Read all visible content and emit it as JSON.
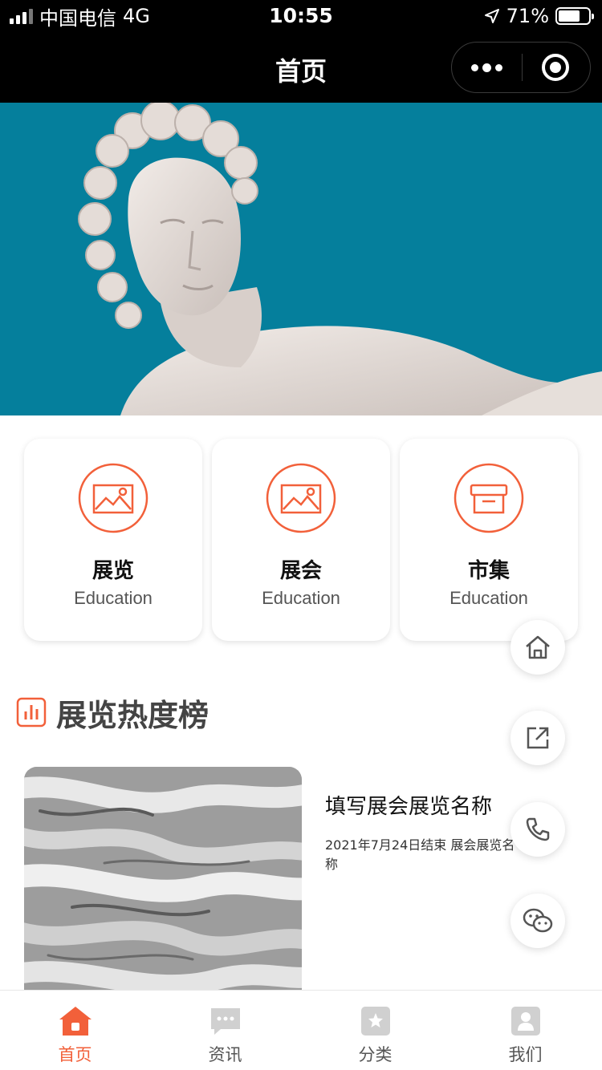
{
  "status_bar": {
    "carrier": "中国电信",
    "network": "4G",
    "time": "10:55",
    "battery": "71%",
    "battery_level": 0.71
  },
  "nav": {
    "title": "首页"
  },
  "categories": [
    {
      "title": "展览",
      "subtitle": "Education",
      "icon": "image-icon"
    },
    {
      "title": "展会",
      "subtitle": "Education",
      "icon": "image-icon"
    },
    {
      "title": "市集",
      "subtitle": "Education",
      "icon": "shop-box-icon"
    }
  ],
  "floating_actions": [
    "home-icon",
    "share-icon",
    "phone-icon",
    "wechat-icon"
  ],
  "ranking": {
    "title": "展览热度榜",
    "items": [
      {
        "name": "填写展会展览名称",
        "desc": "2021年7月24日结束 展会展览名称"
      }
    ]
  },
  "tabs": [
    {
      "label": "首页",
      "icon": "home-icon",
      "active": true
    },
    {
      "label": "资讯",
      "icon": "message-icon",
      "active": false
    },
    {
      "label": "分类",
      "icon": "category-icon",
      "active": false
    },
    {
      "label": "我们",
      "icon": "user-icon",
      "active": false
    }
  ],
  "colors": {
    "accent": "#f2603a",
    "banner": "#057f9c",
    "nav": "#000000"
  }
}
